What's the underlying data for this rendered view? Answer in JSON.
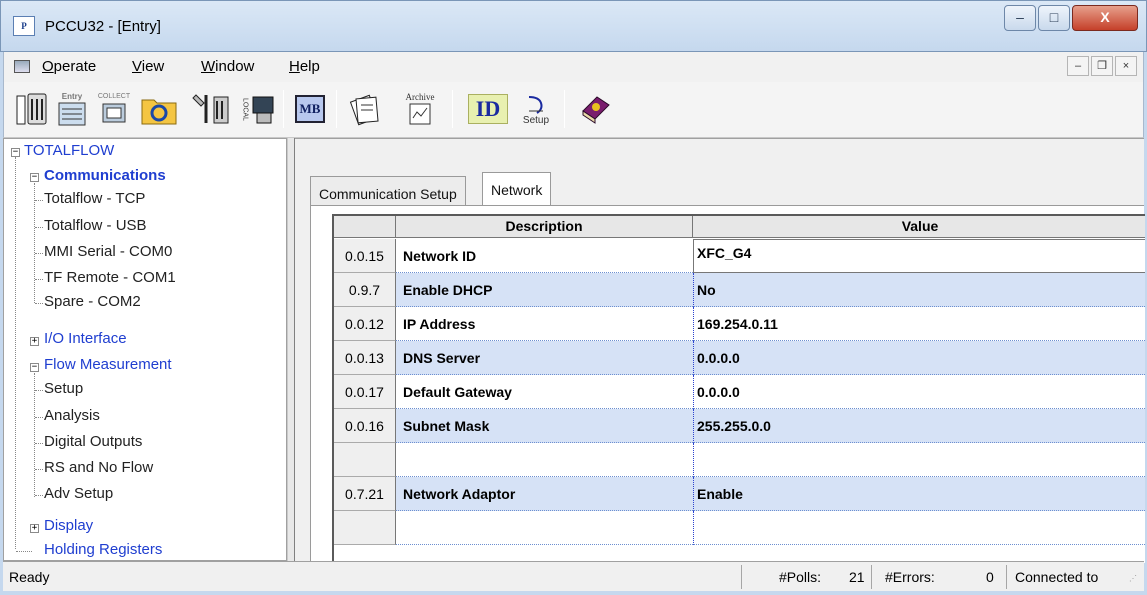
{
  "window": {
    "app_icon_text": "P",
    "title": "PCCU32 - [Entry]",
    "min_glyph": "–",
    "max_glyph": "□",
    "close_glyph": "X"
  },
  "menu": {
    "items": [
      {
        "accel": "O",
        "rest": "perate"
      },
      {
        "accel": "V",
        "rest": "iew"
      },
      {
        "accel": "W",
        "rest": "indow"
      },
      {
        "accel": "H",
        "rest": "elp"
      }
    ],
    "mdi_min": "–",
    "mdi_restore": "❐",
    "mdi_close": "×"
  },
  "toolbar": {
    "entry_label": "Entry",
    "collect_label": "COLLECT",
    "local_label": "LOCAL",
    "mb_label": "MB",
    "archive_label": "Archive",
    "id_label": "ID",
    "setup_label": "Setup"
  },
  "tree": {
    "root": "TOTALFLOW",
    "communications": "Communications",
    "comm_children": [
      "Totalflow - TCP",
      "Totalflow - USB",
      "MMI Serial - COM0",
      "TF Remote - COM1",
      "Spare - COM2"
    ],
    "io_interface": "I/O Interface",
    "flow_measurement": "Flow Measurement",
    "flow_children": [
      "Setup",
      "Analysis",
      "Digital Outputs",
      "RS and No Flow",
      "Adv Setup"
    ],
    "display": "Display",
    "holding_registers": "Holding Registers"
  },
  "tabs": {
    "communication_setup": "Communication Setup",
    "network": "Network"
  },
  "grid": {
    "header_description": "Description",
    "header_value": "Value",
    "rows": [
      {
        "idx": "0.0.15",
        "desc": "Network ID",
        "value": "XFC_G4"
      },
      {
        "idx": "0.9.7",
        "desc": "Enable DHCP",
        "value": "No"
      },
      {
        "idx": "0.0.12",
        "desc": "IP Address",
        "value": "169.254.0.11"
      },
      {
        "idx": "0.0.13",
        "desc": "DNS Server",
        "value": "0.0.0.0"
      },
      {
        "idx": "0.0.17",
        "desc": "Default Gateway",
        "value": "0.0.0.0"
      },
      {
        "idx": "0.0.16",
        "desc": "Subnet Mask",
        "value": "255.255.0.0"
      },
      {
        "idx": "",
        "desc": "",
        "value": ""
      },
      {
        "idx": "0.7.21",
        "desc": "Network Adaptor",
        "value": "Enable"
      },
      {
        "idx": "",
        "desc": "",
        "value": ""
      }
    ]
  },
  "status": {
    "ready": "Ready",
    "polls_label": "#Polls:",
    "polls_value": "21",
    "errors_label": "#Errors:",
    "errors_value": "0",
    "connection": "Connected to"
  }
}
